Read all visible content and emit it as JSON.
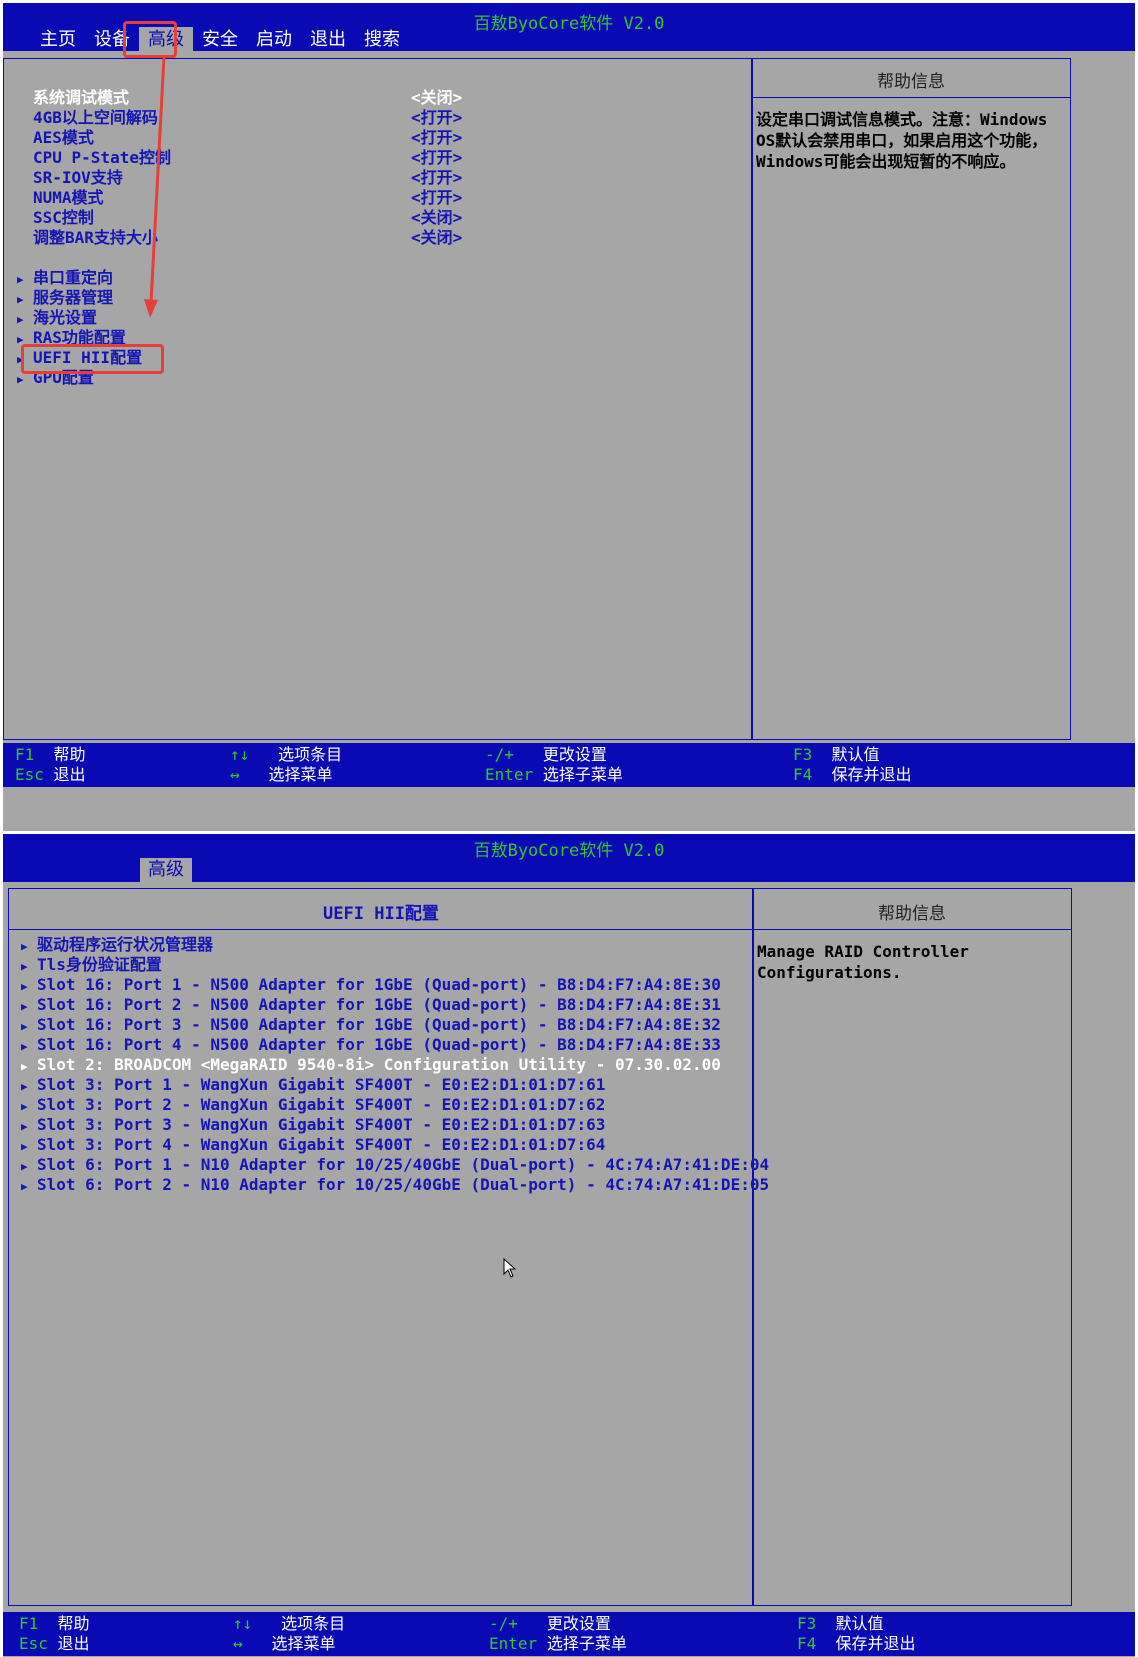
{
  "app_title": "百敖ByoCore软件 V2.0",
  "screen1": {
    "menu": [
      "主页",
      "设备",
      "高级",
      "安全",
      "启动",
      "退出",
      "搜索"
    ],
    "active_menu": "高级",
    "settings": [
      {
        "label": "系统调试模式",
        "value": "<关闭>",
        "selected": true
      },
      {
        "label": "4GB以上空间解码",
        "value": "<打开>"
      },
      {
        "label": "AES模式",
        "value": "<打开>"
      },
      {
        "label": "CPU P-State控制",
        "value": "<打开>"
      },
      {
        "label": "SR-IOV支持",
        "value": "<打开>"
      },
      {
        "label": "NUMA模式",
        "value": "<打开>"
      },
      {
        "label": "SSC控制",
        "value": "<关闭>"
      },
      {
        "label": "调整BAR支持大小",
        "value": "<关闭>"
      }
    ],
    "submenus": [
      "串口重定向",
      "服务器管理",
      "海光设置",
      "RAS功能配置",
      "UEFI HII配置",
      "GPU配置"
    ],
    "help_title": "帮助信息",
    "help_text": "设定串口调试信息模式。注意：Windows OS默认会禁用串口，如果启用这个功能，Windows可能会出现短暂的不响应。"
  },
  "screen2": {
    "tab": "高级",
    "panel_title": "UEFI HII配置",
    "items": [
      "驱动程序运行状况管理器",
      "Tls身份验证配置",
      "Slot 16: Port 1 - N500 Adapter for 1GbE (Quad-port) - B8:D4:F7:A4:8E:30",
      "Slot 16: Port 2 - N500 Adapter for 1GbE (Quad-port) - B8:D4:F7:A4:8E:31",
      "Slot 16: Port 3 - N500 Adapter for 1GbE (Quad-port) - B8:D4:F7:A4:8E:32",
      "Slot 16: Port 4 - N500 Adapter for 1GbE (Quad-port) - B8:D4:F7:A4:8E:33",
      "Slot 2: BROADCOM <MegaRAID 9540-8i> Configuration Utility - 07.30.02.00",
      "Slot 3: Port 1 - WangXun Gigabit SF400T - E0:E2:D1:01:D7:61",
      "Slot 3: Port 2 - WangXun Gigabit SF400T - E0:E2:D1:01:D7:62",
      "Slot 3: Port 3 - WangXun Gigabit SF400T - E0:E2:D1:01:D7:63",
      "Slot 3: Port 4 - WangXun Gigabit SF400T - E0:E2:D1:01:D7:64",
      "Slot 6: Port 1 - N10 Adapter for 10/25/40GbE (Dual-port) - 4C:74:A7:41:DE:04",
      "Slot 6: Port 2 - N10 Adapter for 10/25/40GbE (Dual-port) - 4C:74:A7:41:DE:05"
    ],
    "selected_index": 6,
    "help_title": "帮助信息",
    "help_text": "Manage RAID Controller Configurations."
  },
  "footer": {
    "f1_key": "F1",
    "f1_desc": "帮助",
    "esc_key": "Esc",
    "esc_desc": "退出",
    "ud_key": "↑↓",
    "ud_desc": "选项条目",
    "lr_key": "↔",
    "lr_desc": "选择菜单",
    "pm_key": "-/+",
    "pm_desc": "更改设置",
    "enter_key": "Enter",
    "enter_desc": "选择子菜单",
    "f3_key": "F3",
    "f3_desc": "默认值",
    "f4_key": "F4",
    "f4_desc": "保存并退出"
  },
  "colors": {
    "bios_blue": "#0a0ab4",
    "bios_gray": "#a6a6a6",
    "title_green": "#2ec82e",
    "highlight_red": "#e4403a"
  }
}
